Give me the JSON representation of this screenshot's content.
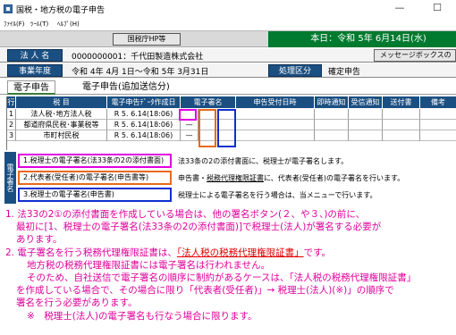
{
  "window": {
    "title": "国税・地方税の電子申告",
    "minimize_glyph": "—",
    "maximize_glyph": "☐"
  },
  "menu": {
    "file": "ﾌｧｲﾙ(F)",
    "tool": "ﾂｰﾙ(T)",
    "help": "ﾍﾙﾌﾟ(H)"
  },
  "toolbar": {
    "homepage_button": "国税庁HP等",
    "today": "本日：令和 5年 6月14日(水)"
  },
  "info": {
    "corp_label": "法 人 名",
    "corp_value": "0000000001：千代田製造株式会社",
    "message_button": "メッセージボックスの",
    "year_label": "事業年度",
    "year_value": "令和 4年 4月 1日～令和 5年 3月31日",
    "process_label": "処理区分",
    "process_value": "確定申告"
  },
  "tabs": [
    {
      "label": "電子申告"
    },
    {
      "label": "電子申告(追加送信分)"
    }
  ],
  "table": {
    "headers": [
      "行",
      "税 目",
      "電子申告ﾃﾞｰﾀ作成日",
      "電子署名",
      "申告受付日時",
      "即時通知",
      "受信通知",
      "送付書",
      "備考"
    ],
    "rows": [
      {
        "no": "1",
        "tax": "法人税･地方法人税",
        "created": "R 5. 6.14(18:06)",
        "sig": ""
      },
      {
        "no": "2",
        "tax": "都道府県民税･事業税等",
        "created": "R 5. 6.14(18:06)",
        "sig": "—"
      },
      {
        "no": "3",
        "tax": "市町村民税",
        "created": "R 5. 6.14(18:06)",
        "sig": "—"
      }
    ]
  },
  "signing": {
    "side_label": "電子署名",
    "buttons": [
      {
        "label": "1.税理士の電子署名(法33条の2の添付書面)",
        "desc": "法33条の2の添付書面に、税理士が電子署名します。"
      },
      {
        "label": "2.代表者(受任者)の電子署名(申告書等)",
        "desc_pre": "申告書・",
        "desc_link": "税務代理権限証書",
        "desc_post": "に、代表者(受任者)の電子署名を行います。"
      },
      {
        "label": "3.税理士の電子署名(申告書)",
        "desc": "税理士による電子署名を行う場合は、当メニューで行います。"
      }
    ]
  },
  "notes": {
    "n1_l1": "1. 法33の2①の添付書面を作成している場合は、他の署名ボタン(２、や３、)の前に、",
    "n1_l2": "最初に[1、税理士の電子署名(法33条の2の添付書面)]で税理士(法人)が署名する必要が",
    "n1_l3": "あります。",
    "n2_pre": "2. 電子署名を行う税務代理権限証書は、",
    "n2_red": "「法人税の税務代理権限証書」",
    "n2_post": "です。",
    "n2_l2": "地方税の税務代理権限証書には電子署名は行われません。",
    "n2_l3": "そのため、自社送信で電子署名の順序に制約があるケースは、「法人税の税務代理権限証書」",
    "n2_l4": "を作成している場合で、その場合に限り「代表者(受任者)」→ 税理士(法人)(※)」の順序で",
    "n2_l5": "署名を行う必要があります。",
    "n2_l6": "※　税理士(法人)の電子署名も行なう場合に限ります。"
  },
  "colors": {
    "header_blue": "#1b4f82",
    "date_green": "#007a2e",
    "note_magenta": "#e0009a",
    "note_red": "#e00000",
    "hl_magenta": "#e000e0",
    "hl_orange": "#e86a1c",
    "hl_blue": "#1030d0"
  }
}
